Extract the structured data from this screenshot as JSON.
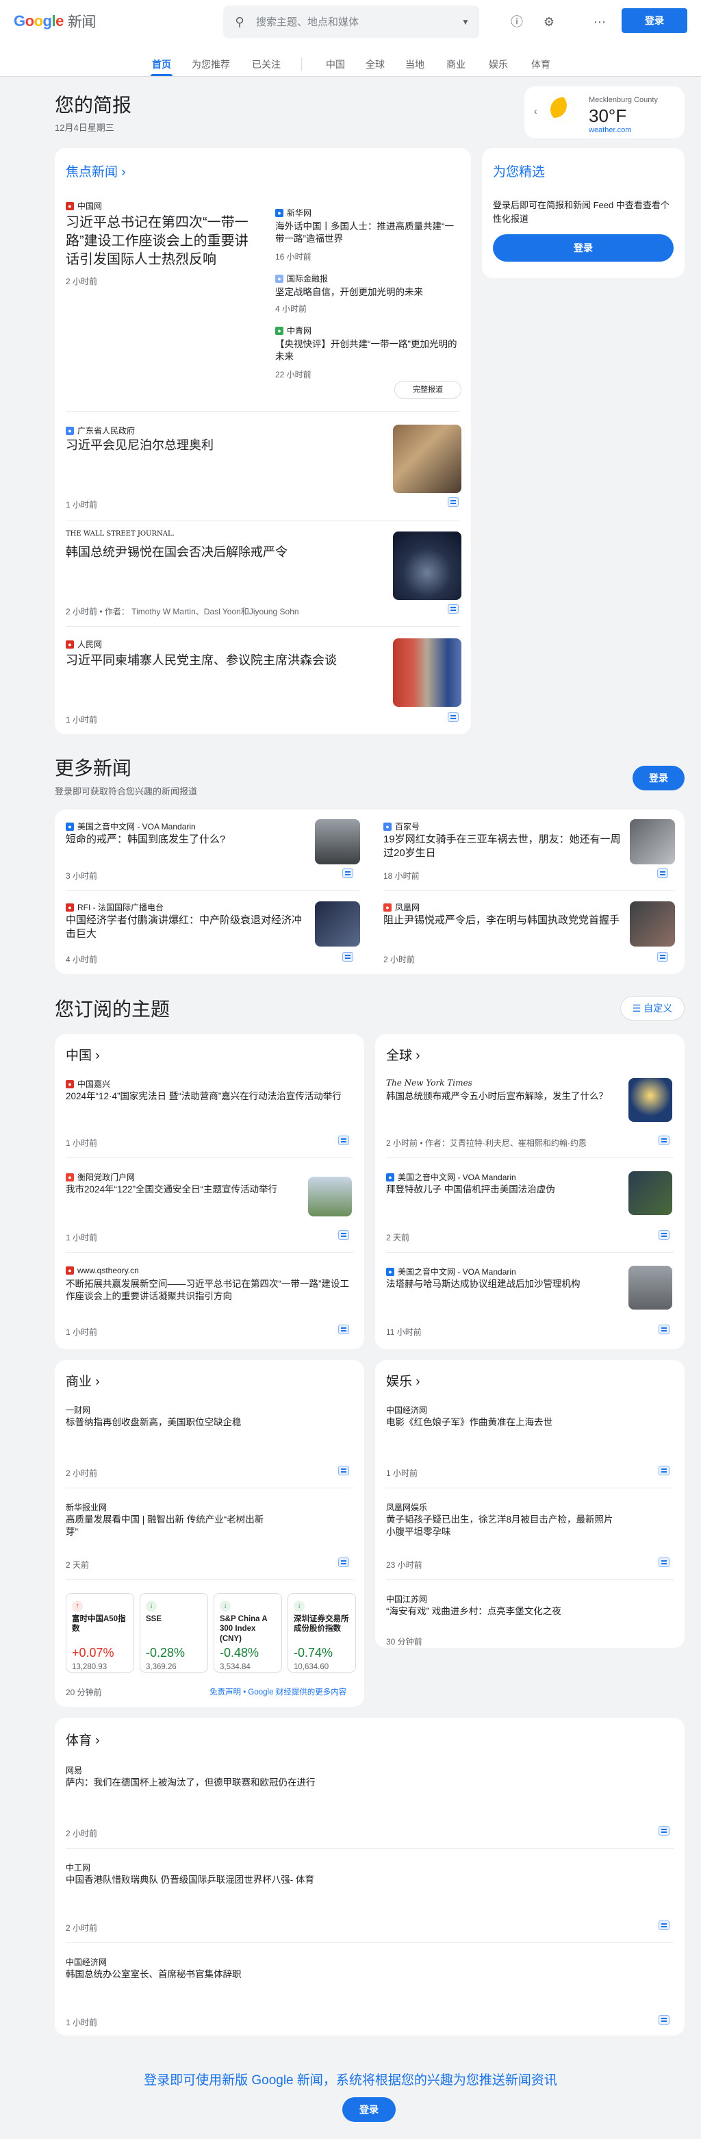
{
  "header": {
    "search_placeholder": "搜索主题、地点和媒体",
    "signin": "登录",
    "logo_news": "新闻"
  },
  "tabs": [
    "首页",
    "为您推荐",
    "已关注",
    "中国",
    "全球",
    "当地",
    "商业",
    "娱乐",
    "体育"
  ],
  "briefing": {
    "title": "您的简报",
    "date": "12月4日星期三"
  },
  "weather": {
    "location": "Mecklenburg County",
    "temp": "30°F",
    "source": "weather.com"
  },
  "top": {
    "title": "焦点新闻",
    "main": {
      "source": "中国网",
      "headline": "习近平总书记在第四次“一带一路”建设工作座谈会上的重要讲话引发国际人士热烈反响",
      "time": "2 小时前"
    },
    "side": [
      {
        "source": "新华网",
        "headline": "海外话中国丨多国人士：推进高质量共建“一带一路”造福世界",
        "time": "16 小时前"
      },
      {
        "source": "国际金融报",
        "headline": "坚定战略自信，开创更加光明的未来",
        "time": "4 小时前"
      },
      {
        "source": "中青网",
        "headline": "【央视快评】开创共建“一带一路”更加光明的未来",
        "time": "22 小时前"
      }
    ],
    "full_coverage": "完整报道",
    "stories": [
      {
        "source": "广东省人民政府",
        "headline": "习近平会见尼泊尔总理奥利",
        "time": "1 小时前"
      },
      {
        "source": "THE WALL STREET JOURNAL.",
        "headline": "韩国总统尹锡悦在国会否决后解除戒严令",
        "time": "2 小时前 • 作者： Timothy W Martin、Dasl Yoon和Jiyoung Sohn"
      },
      {
        "source": "人民网",
        "headline": "习近平同柬埔寨人民党主席、参议院主席洪森会谈",
        "time": "1 小时前"
      }
    ]
  },
  "picks": {
    "title": "为您精选",
    "text": "登录后即可在简报和新闻 Feed 中查看查看个性化报道",
    "button": "登录"
  },
  "more": {
    "title": "更多新闻",
    "subtitle": "登录即可获取符合您兴趣的新闻报道",
    "button": "登录",
    "items": [
      {
        "source": "美国之音中文网 - VOA Mandarin",
        "headline": "短命的戒严：韩国到底发生了什么?",
        "time": "3 小时前"
      },
      {
        "source": "百家号",
        "headline": "19岁网红女骑手在三亚车祸去世，朋友：她还有一周过20岁生日",
        "time": "18 小时前"
      },
      {
        "source": "RFI - 法国国际广播电台",
        "headline": "中国经济学者付鹏演讲爆红：中产阶级衰退对经济冲击巨大",
        "time": "4 小时前"
      },
      {
        "source": "凤凰网",
        "headline": "阻止尹锡悦戒严令后，李在明与韩国执政党党首握手",
        "time": "2 小时前"
      }
    ]
  },
  "subscribed": {
    "title": "您订阅的主题",
    "customize": "自定义"
  },
  "china": {
    "title": "中国",
    "items": [
      {
        "source": "中国嘉兴",
        "headline": "2024年“12·4”国家宪法日 暨“法助营商”嘉兴在行动法治宣传活动举行",
        "time": "1 小时前"
      },
      {
        "source": "衡阳党政门户网",
        "headline": "我市2024年“122”全国交通安全日“主题宣传活动举行",
        "time": "1 小时前"
      },
      {
        "source": "www.qstheory.cn",
        "headline": "不断拓展共赢发展新空间——习近平总书记在第四次“一带一路”建设工作座谈会上的重要讲话凝聚共识指引方向",
        "time": "1 小时前"
      }
    ]
  },
  "world": {
    "title": "全球",
    "items": [
      {
        "source": "The New York Times",
        "headline": "韩国总统颁布戒严令五小时后宣布解除，发生了什么？",
        "time": "2 小时前 • 作者：艾青拉特·利夫尼、崔相熙和约翰·约恩"
      },
      {
        "source": "美国之音中文网 - VOA Mandarin",
        "headline": "拜登特赦儿子 中国借机抨击美国法治虚伪",
        "time": "2 天前"
      },
      {
        "source": "美国之音中文网 - VOA Mandarin",
        "headline": "法塔赫与哈马斯达成协议组建战后加沙管理机构",
        "time": "11 小时前"
      }
    ]
  },
  "business": {
    "title": "商业",
    "items": [
      {
        "source": "一财网",
        "headline": "标普纳指再创收盘新高，美国职位空缺企稳",
        "time": "2 小时前"
      },
      {
        "source": "新华报业网",
        "headline": "高质量发展看中国 | 融智出新 传统产业“老树出新芽”",
        "time": "2 天前"
      }
    ],
    "stocks": [
      {
        "name": "富时中国A50指数",
        "change": "+0.07%",
        "price": "13,280.93",
        "dir": "up"
      },
      {
        "name": "SSE",
        "change": "-0.28%",
        "price": "3,369.26",
        "dir": "dn"
      },
      {
        "name": "S&P China A 300 Index (CNY)",
        "change": "-0.48%",
        "price": "3,534.84",
        "dir": "dn"
      },
      {
        "name": "深圳证券交易所成份股价指数",
        "change": "-0.74%",
        "price": "10,634.60",
        "dir": "dn"
      }
    ],
    "stocks_time": "20 分钟前",
    "disclaimer": "免责声明 • Google 财经提供的更多内容"
  },
  "ent": {
    "title": "娱乐",
    "items": [
      {
        "source": "中国经济网",
        "headline": "电影《红色娘子军》作曲黄准在上海去世",
        "time": "1 小时前"
      },
      {
        "source": "凤凰网娱乐",
        "headline": "黄子韬孩子疑已出生，徐艺洋8月被目击产检，最新照片小腹平坦零孕味",
        "time": "23 小时前"
      },
      {
        "source": "中国江苏网",
        "headline": "“海安有戏” 戏曲进乡村：点亮李堡文化之夜",
        "time": "30 分钟前"
      }
    ]
  },
  "sports": {
    "title": "体育",
    "items": [
      {
        "source": "网易",
        "headline": "萨内：我们在德国杯上被淘汰了，但德甲联赛和欧冠仍在进行",
        "time": "2 小时前"
      },
      {
        "source": "中工网",
        "headline": "中国香港队惜败瑞典队 仍晋级国际乒联混团世界杯八强- 体育",
        "time": "2 小时前"
      },
      {
        "source": "中国经济网",
        "headline": "韩国总统办公室室长、首席秘书官集体辞职",
        "time": "1 小时前"
      }
    ]
  },
  "footer": {
    "text": "登录即可使用新版 Google 新闻，系统将根据您的兴趣为您推送新闻资讯",
    "button": "登录"
  }
}
